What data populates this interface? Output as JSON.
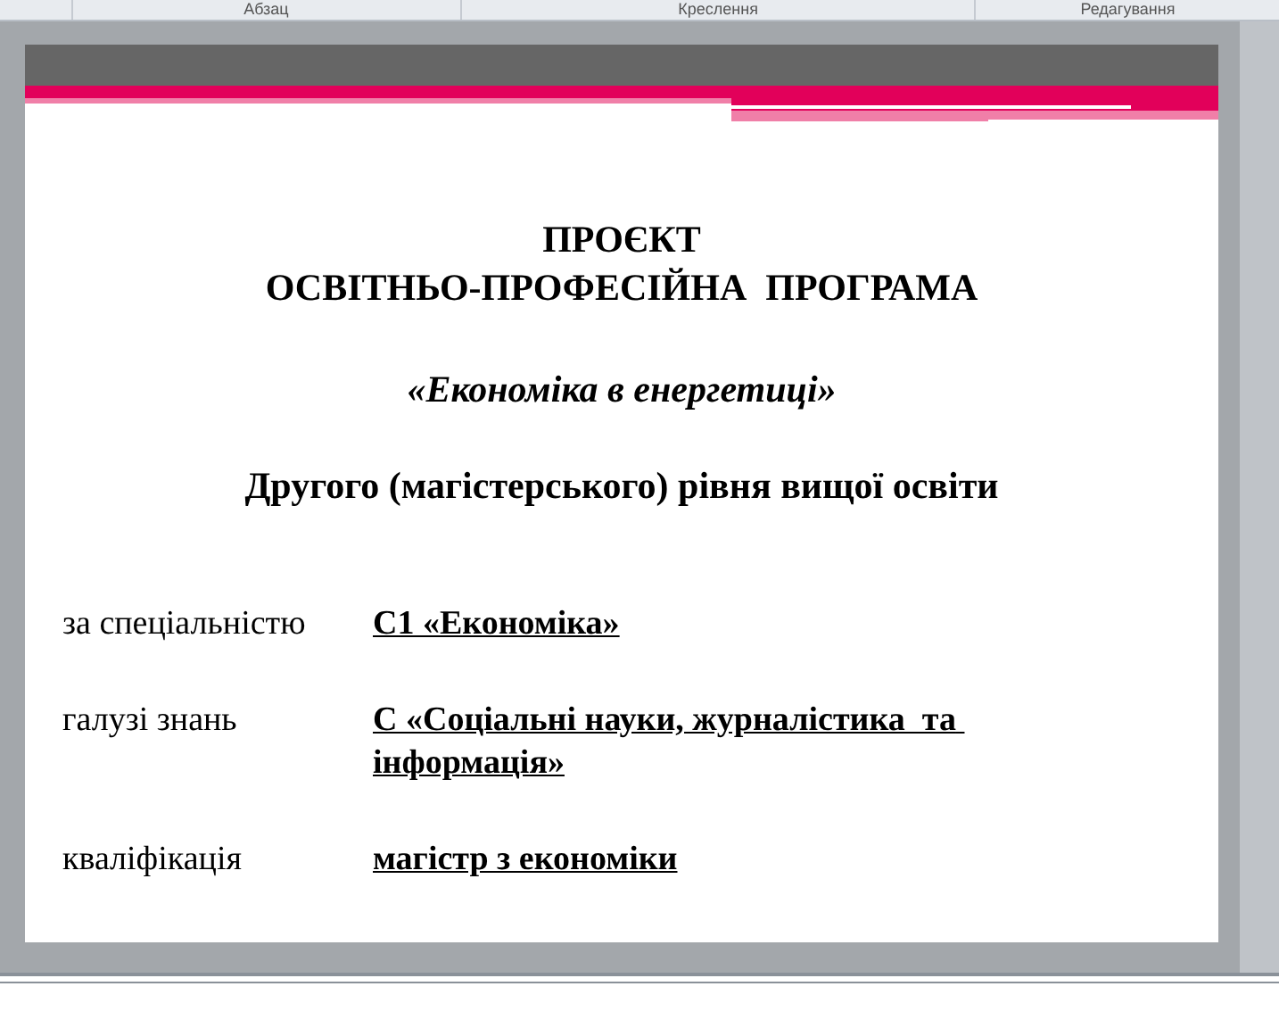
{
  "ribbon": {
    "groups": [
      "Абзац",
      "Креслення",
      "Редагування"
    ]
  },
  "slide": {
    "title_lines": [
      "ПРОЄКТ",
      "ОСВІТНЬО-ПРОФЕСІЙНА  ПРОГРАМА"
    ],
    "program_name": "«Економіка в енергетиці»",
    "level": "Другого (магістерського) рівня вищої освіти",
    "fields": [
      {
        "label": "за спеціальністю",
        "value": "С1 «Економіка»"
      },
      {
        "label": "галузі знань",
        "value": "С «Соціальні науки, журналістика  та інформація»"
      },
      {
        "label": "кваліфікація",
        "value": "магістр з економіки"
      }
    ]
  }
}
